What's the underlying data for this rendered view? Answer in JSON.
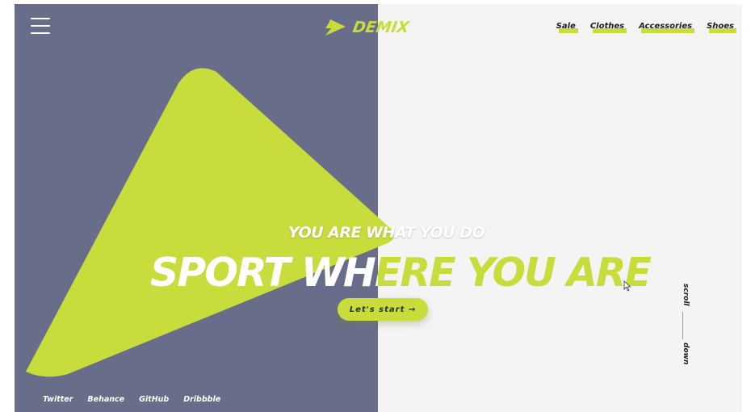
{
  "brand": {
    "name": "DEMIX",
    "accent": "#c8dc3c",
    "panel_left": "#686e89",
    "panel_right": "#f4f4f5"
  },
  "header": {
    "menu_icon": "hamburger-icon",
    "nav": [
      {
        "label": "Sale"
      },
      {
        "label": "Clothes"
      },
      {
        "label": "Accessories"
      },
      {
        "label": "Shoes"
      }
    ]
  },
  "hero": {
    "tagline": "YOU ARE WHAT YOU DO",
    "headline": "SPORT WHERE YOU ARE",
    "cta_label": "Let's start →"
  },
  "scroll": {
    "top": "scroll",
    "bottom": "down"
  },
  "social": [
    {
      "label": "Twitter"
    },
    {
      "label": "Behance"
    },
    {
      "label": "GitHub"
    },
    {
      "label": "Dribbble"
    }
  ]
}
